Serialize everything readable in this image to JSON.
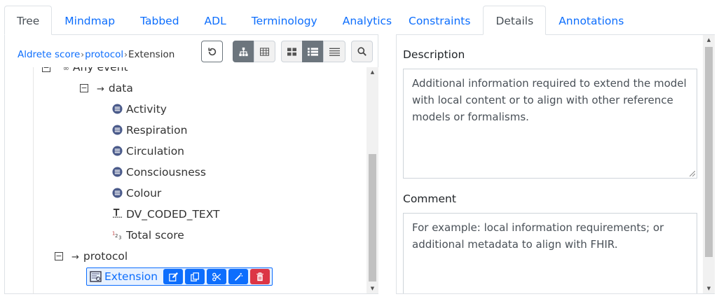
{
  "left_tabs": [
    "Tree",
    "Mindmap",
    "Tabbed",
    "ADL",
    "Terminology",
    "Analytics"
  ],
  "right_tabs": [
    "Constraints",
    "Details",
    "Annotations"
  ],
  "active_left_tab": "Tree",
  "active_right_tab": "Details",
  "breadcrumb": {
    "items": [
      "Aldrete score",
      "protocol"
    ],
    "separator": "›",
    "current": "Extension"
  },
  "toolbar_icons": [
    "refresh-icon",
    "hierarchy-icon",
    "table-icon",
    "tiles-icon",
    "list-icon",
    "rows-icon",
    "search-icon"
  ],
  "tree": {
    "any_event": "Any event",
    "data": "data",
    "elements": [
      "Activity",
      "Respiration",
      "Circulation",
      "Consciousness",
      "Colour"
    ],
    "coded_text": "DV_CODED_TEXT",
    "total_score": "Total score",
    "protocol": "protocol",
    "selected": "Extension"
  },
  "details": {
    "description_label": "Description",
    "description_text": "Additional information required to extend the model with local content or to align with other reference models or formalisms.",
    "comment_label": "Comment",
    "comment_text": "For example: local information requirements; or additional metadata to align with FHIR."
  },
  "colors": {
    "link": "#0d6efd",
    "danger": "#dc3545",
    "secondary": "#6c757d"
  }
}
